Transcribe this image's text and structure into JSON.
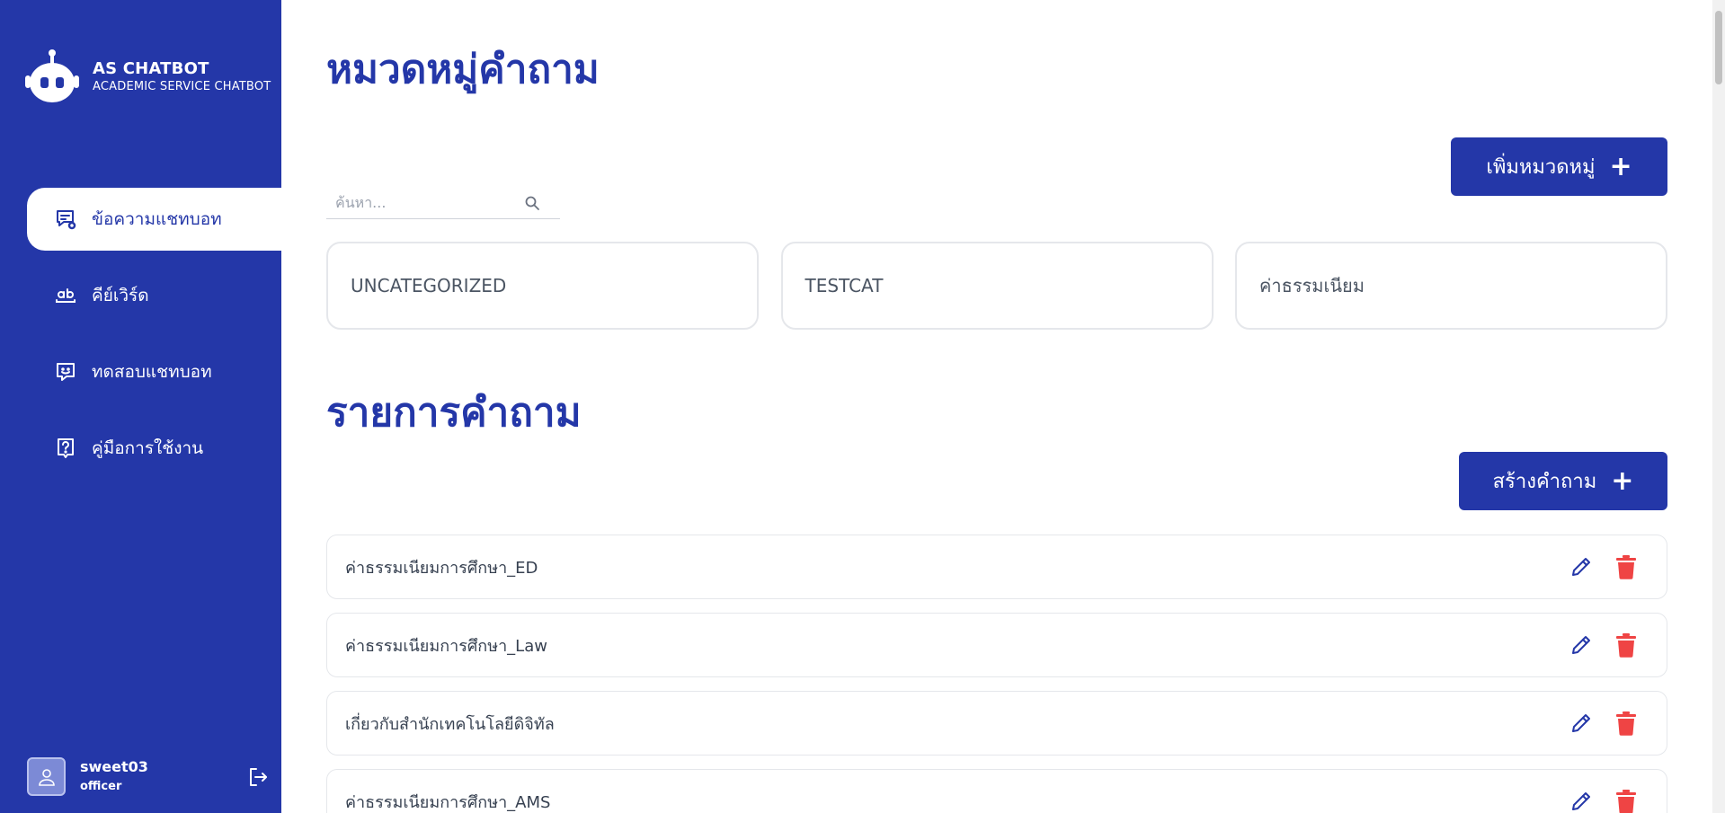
{
  "colors": {
    "primary": "#2437a8",
    "danger": "#ef4444",
    "white": "#ffffff"
  },
  "brand": {
    "title": "AS CHATBOT",
    "subtitle": "ACADEMIC SERVICE CHATBOT",
    "logo": "robot-icon"
  },
  "sidebar": {
    "items": [
      {
        "label": "ข้อความแชทบอท",
        "icon": "chat-settings-icon",
        "active": true
      },
      {
        "label": "คีย์เวิร์ด",
        "icon": "keyword-icon",
        "active": false
      },
      {
        "label": "ทดสอบแชทบอท",
        "icon": "chat-smile-icon",
        "active": false
      },
      {
        "label": "คู่มือการใช้งาน",
        "icon": "help-icon",
        "active": false
      }
    ]
  },
  "user": {
    "name": "sweet03",
    "role": "officer"
  },
  "categories": {
    "title": "หมวดหมู่คำถาม",
    "add_label": "เพิ่มหมวดหมู่",
    "search_placeholder": "ค้นหา...",
    "items": [
      "UNCATEGORIZED",
      "TESTCAT",
      "ค่าธรรมเนียม"
    ]
  },
  "questions": {
    "title": "รายการคำถาม",
    "create_label": "สร้างคำถาม",
    "items": [
      "ค่าธรรมเนียมการศึกษา_ED",
      "ค่าธรรมเนียมการศึกษา_Law",
      "เกี่ยวกับสำนักเทคโนโลยีดิจิทัล",
      "ค่าธรรมเนียมการศึกษา_AMS"
    ]
  }
}
